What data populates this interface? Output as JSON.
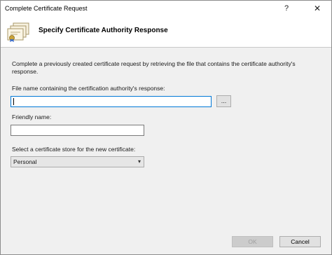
{
  "window": {
    "title": "Complete Certificate Request",
    "help_label": "?",
    "close_label": "✕"
  },
  "header": {
    "title": "Specify Certificate Authority Response",
    "icon": "certificate-icon"
  },
  "form": {
    "description": "Complete a previously created certificate request by retrieving the file that contains the certificate authority's response.",
    "file_label": "File name containing the certification authority's response:",
    "file_value": "",
    "browse_label": "...",
    "friendly_label": "Friendly name:",
    "friendly_value": "",
    "store_label": "Select a certificate store for the new certificate:",
    "store_value": "Personal"
  },
  "footer": {
    "ok_label": "OK",
    "cancel_label": "Cancel"
  }
}
